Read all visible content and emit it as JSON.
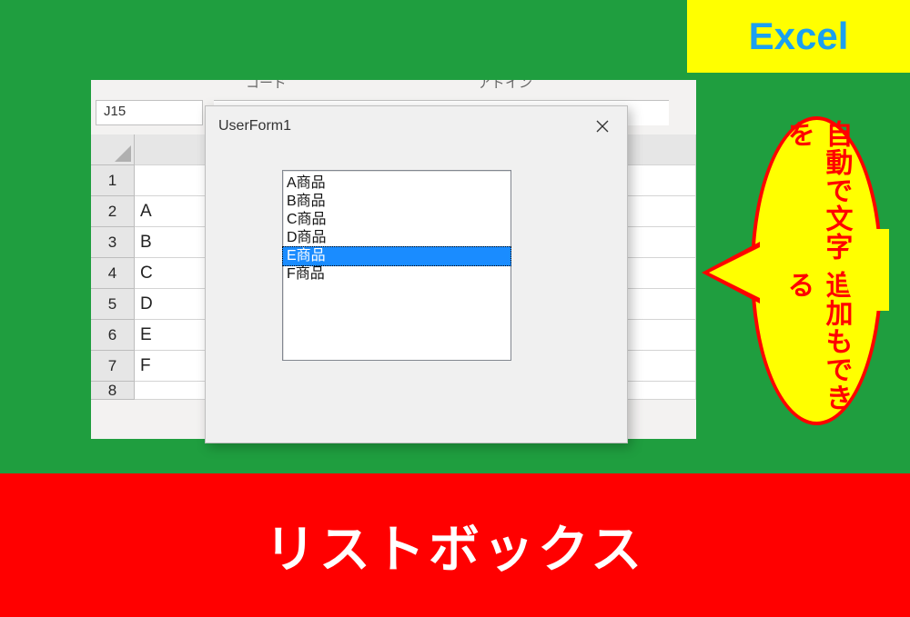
{
  "badge": {
    "label": "Excel"
  },
  "banner": {
    "title": "リストボックス"
  },
  "bubble": {
    "line1": "自動で文字を",
    "line2": "追加もできる"
  },
  "ribbon": {
    "left_hint": "コード",
    "right_hint": "アドイン"
  },
  "namebox": {
    "value": "J15"
  },
  "sheet": {
    "rows": [
      {
        "num": "1",
        "a": ""
      },
      {
        "num": "2",
        "a": "A"
      },
      {
        "num": "3",
        "a": "B"
      },
      {
        "num": "4",
        "a": "C"
      },
      {
        "num": "5",
        "a": "D"
      },
      {
        "num": "6",
        "a": "E"
      },
      {
        "num": "7",
        "a": "F"
      },
      {
        "num": "8",
        "a": ""
      }
    ]
  },
  "dialog": {
    "title": "UserForm1",
    "listbox": {
      "items": [
        {
          "label": "A商品",
          "selected": false
        },
        {
          "label": "B商品",
          "selected": false
        },
        {
          "label": "C商品",
          "selected": false
        },
        {
          "label": "D商品",
          "selected": false
        },
        {
          "label": "E商品",
          "selected": true
        },
        {
          "label": "F商品",
          "selected": false
        }
      ]
    }
  }
}
